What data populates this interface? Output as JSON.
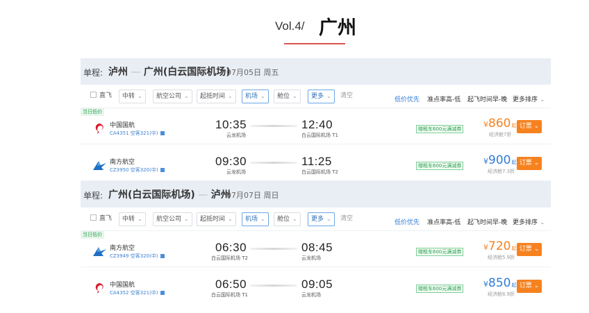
{
  "header": {
    "vol": "Vol.4/",
    "city": "广州"
  },
  "common": {
    "trip_label": "单程:",
    "filters": [
      "直飞",
      "中转",
      "航空公司",
      "起抵时间",
      "机场",
      "舱位",
      "更多",
      "清空"
    ],
    "sorts": [
      "低价优先",
      "准点率高-低",
      "起飞时间早-晚",
      "更多排序"
    ],
    "tag": "当日低价",
    "promo": "赠租车600元满减券",
    "yen": "¥",
    "qi": "起",
    "book": "订票",
    "chevron": "⌄"
  },
  "trips": [
    {
      "route_from": "泸州",
      "route_to": "广州(白云国际机场)",
      "date": "07月05日 周五",
      "flights": [
        {
          "airline": "中国国航",
          "logo": "air-china-logo",
          "number": "CA4351 空客321(中)",
          "dep_time": "10:35",
          "dep_airport": "云龙机场",
          "arr_time": "12:40",
          "arr_airport": "白云国际机场 T1",
          "price": "860",
          "price_color": "#f6821f",
          "discount": "经济舱7折",
          "tagged": true
        },
        {
          "airline": "南方航空",
          "logo": "china-southern-logo",
          "number": "CZ3950 空客320(中)",
          "dep_time": "09:30",
          "dep_airport": "云龙机场",
          "arr_time": "11:25",
          "arr_airport": "白云国际机场 T2",
          "price": "900",
          "price_color": "#2f7bd6",
          "discount": "经济舱7.3折",
          "tagged": false
        }
      ]
    },
    {
      "route_from": "广州(白云国际机场)",
      "route_to": "泸州",
      "date": "07月07日 周日",
      "flights": [
        {
          "airline": "南方航空",
          "logo": "china-southern-logo",
          "number": "CZ3949 空客320(中)",
          "dep_time": "06:30",
          "dep_airport": "白云国际机场 T2",
          "arr_time": "08:45",
          "arr_airport": "云龙机场",
          "price": "720",
          "price_color": "#f6821f",
          "discount": "经济舱5.9折",
          "tagged": true
        },
        {
          "airline": "中国国航",
          "logo": "air-china-logo",
          "number": "CA4352 空客321(中)",
          "dep_time": "06:50",
          "dep_airport": "白云国际机场 T1",
          "arr_time": "09:05",
          "arr_airport": "云龙机场",
          "price": "850",
          "price_color": "#2f7bd6",
          "discount": "经济舱6.9折",
          "tagged": false
        }
      ]
    }
  ],
  "colors": {
    "accent_orange": "#f6821f",
    "accent_blue": "#2f7bd6",
    "underline_red": "#d9534f"
  }
}
